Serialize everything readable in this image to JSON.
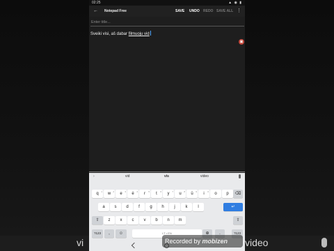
{
  "background": {
    "left_bottom_text": "vi",
    "right_bottom_text": "video"
  },
  "status_bar": {
    "time": "02:25",
    "icons": "▲ ◉ ▮"
  },
  "app_bar": {
    "title": "Notepad Free",
    "actions": {
      "save": "SAVE",
      "undo": "UNDO",
      "redo": "REDO",
      "save_all": "SAVE ALL"
    }
  },
  "editor": {
    "title_placeholder": "Enter title...",
    "body_text_plain": "Sveiki visi, aš dabar ",
    "body_text_underlined": "filmuoju vid"
  },
  "keyboard": {
    "suggestions": [
      "vid",
      "vis",
      "video"
    ],
    "row1": [
      {
        "key": "q",
        "hint": "1"
      },
      {
        "key": "w",
        "hint": "2"
      },
      {
        "key": "e",
        "hint": "3"
      },
      {
        "key": "ė",
        "hint": "4"
      },
      {
        "key": "r",
        "hint": "5"
      },
      {
        "key": "t",
        "hint": "6"
      },
      {
        "key": "y",
        "hint": "7"
      },
      {
        "key": "u",
        "hint": "8"
      },
      {
        "key": "ū",
        "hint": "9"
      },
      {
        "key": "i",
        "hint": "0"
      },
      {
        "key": "o",
        "hint": ""
      },
      {
        "key": "p",
        "hint": ""
      }
    ],
    "row2": [
      "a",
      "s",
      "d",
      "f",
      "g",
      "h",
      "j",
      "k",
      "l"
    ],
    "row3": [
      "z",
      "x",
      "c",
      "v",
      "b",
      "n",
      "m"
    ],
    "row4": {
      "numbers": "?123",
      "comma": ",",
      "space": "LT • EN",
      "period": "."
    },
    "icons": {
      "backspace": "⌫",
      "enter": "↵",
      "shift_left": "⇧",
      "shift_right": "⇧",
      "emoji": "☺",
      "globe": "⊕"
    }
  },
  "watermark": {
    "label": "Recorded by",
    "brand": "mobizen"
  }
}
